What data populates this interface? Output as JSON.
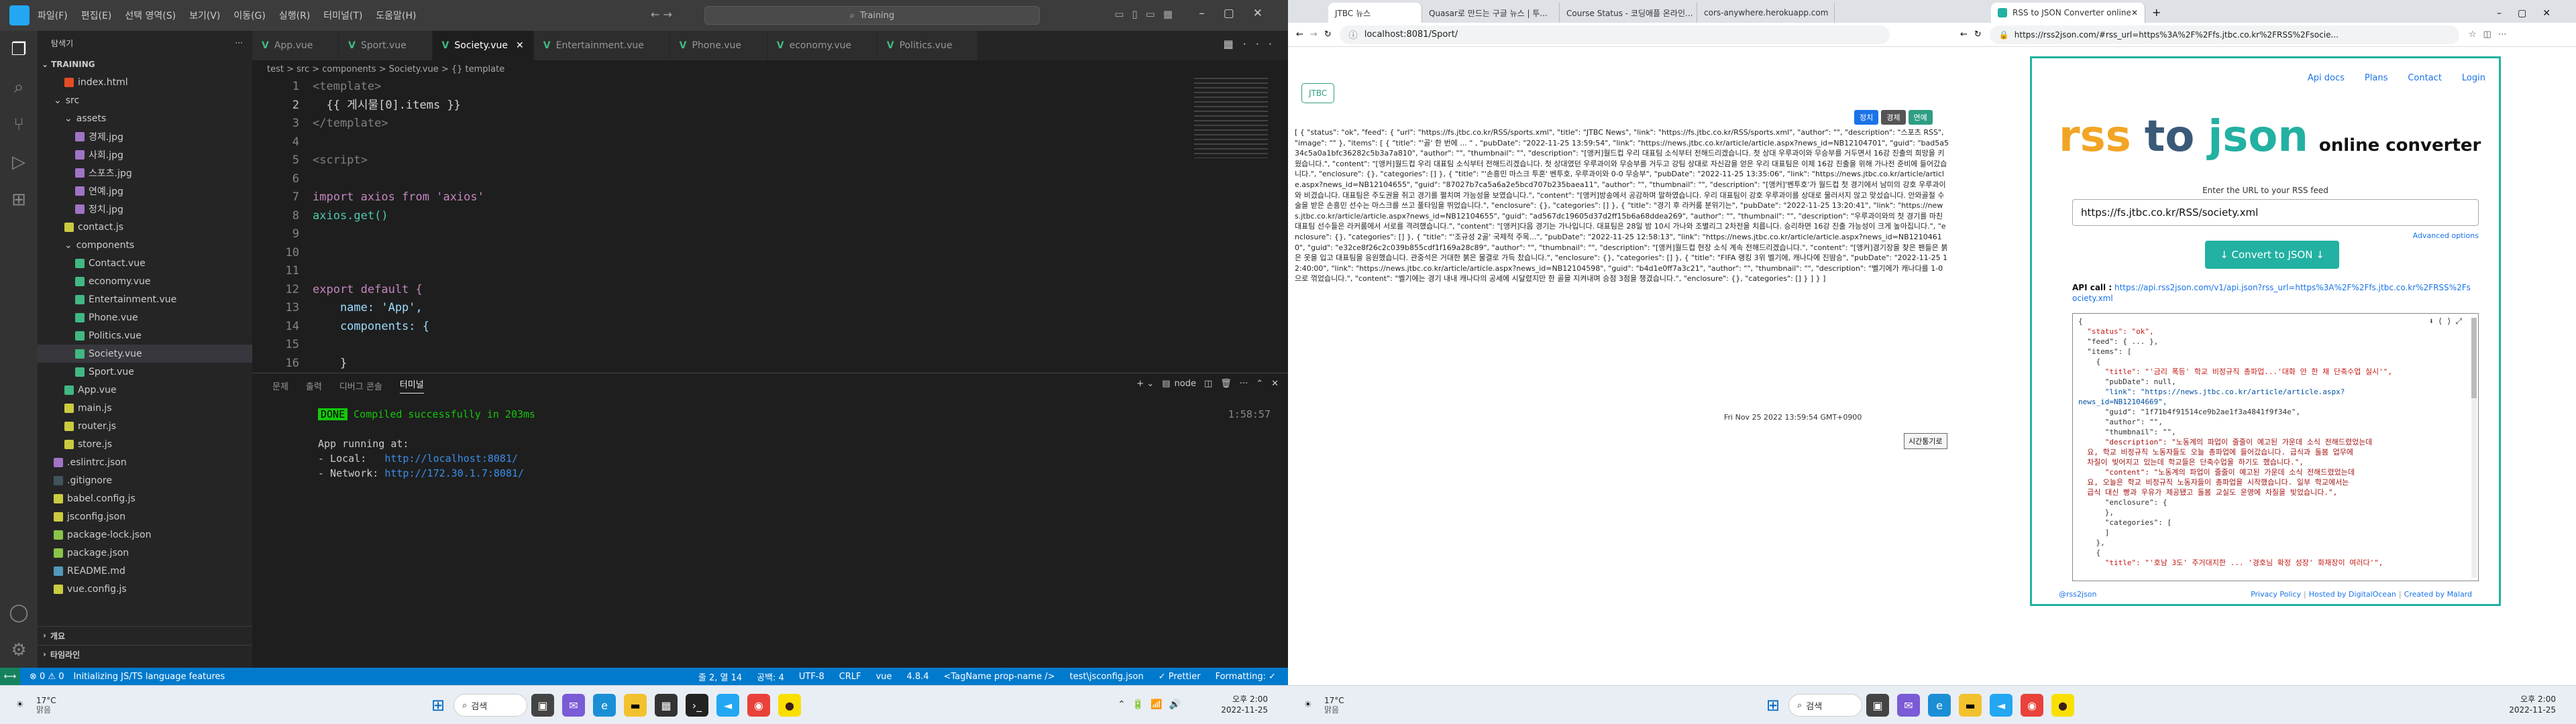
{
  "vscode": {
    "menu": [
      "파일(F)",
      "편집(E)",
      "선택 영역(S)",
      "보기(V)",
      "이동(G)",
      "실행(R)",
      "터미널(T)",
      "도움말(H)"
    ],
    "search": "Training",
    "explorer_title": "탐색기",
    "root": "TRAINING",
    "tree": [
      {
        "n": "index.html",
        "d": 2,
        "c": "#e44d26"
      },
      {
        "n": "src",
        "d": 1,
        "c": "",
        "folder": true
      },
      {
        "n": "assets",
        "d": 2,
        "c": "",
        "folder": true
      },
      {
        "n": "경제.jpg",
        "d": 3,
        "c": "#a074c4"
      },
      {
        "n": "사회.jpg",
        "d": 3,
        "c": "#a074c4"
      },
      {
        "n": "스포츠.jpg",
        "d": 3,
        "c": "#a074c4"
      },
      {
        "n": "연예.jpg",
        "d": 3,
        "c": "#a074c4"
      },
      {
        "n": "정치.jpg",
        "d": 3,
        "c": "#a074c4"
      },
      {
        "n": "contact.js",
        "d": 2,
        "c": "#cbcb41"
      },
      {
        "n": "components",
        "d": 2,
        "c": "",
        "folder": true
      },
      {
        "n": "Contact.vue",
        "d": 3,
        "c": "#41b883"
      },
      {
        "n": "economy.vue",
        "d": 3,
        "c": "#41b883"
      },
      {
        "n": "Entertainment.vue",
        "d": 3,
        "c": "#41b883"
      },
      {
        "n": "Phone.vue",
        "d": 3,
        "c": "#41b883"
      },
      {
        "n": "Politics.vue",
        "d": 3,
        "c": "#41b883"
      },
      {
        "n": "Society.vue",
        "d": 3,
        "c": "#41b883",
        "sel": true
      },
      {
        "n": "Sport.vue",
        "d": 3,
        "c": "#41b883"
      },
      {
        "n": "App.vue",
        "d": 2,
        "c": "#41b883"
      },
      {
        "n": "main.js",
        "d": 2,
        "c": "#cbcb41"
      },
      {
        "n": "router.js",
        "d": 2,
        "c": "#cbcb41"
      },
      {
        "n": "store.js",
        "d": 2,
        "c": "#cbcb41"
      },
      {
        "n": ".eslintrc.json",
        "d": 1,
        "c": "#a074c4"
      },
      {
        "n": ".gitignore",
        "d": 1,
        "c": "#41535b"
      },
      {
        "n": "babel.config.js",
        "d": 1,
        "c": "#cbcb41"
      },
      {
        "n": "jsconfig.json",
        "d": 1,
        "c": "#cbcb41"
      },
      {
        "n": "package-lock.json",
        "d": 1,
        "c": "#8bc34a"
      },
      {
        "n": "package.json",
        "d": 1,
        "c": "#8bc34a"
      },
      {
        "n": "README.md",
        "d": 1,
        "c": "#519aba"
      },
      {
        "n": "vue.config.js",
        "d": 1,
        "c": "#cbcb41"
      }
    ],
    "outline": "개요",
    "timeline": "타임라인",
    "tabs": [
      "App.vue",
      "Sport.vue",
      "Society.vue",
      "Entertainment.vue",
      "Phone.vue",
      "economy.vue",
      "Politics.vue"
    ],
    "active_tab": "Society.vue",
    "breadcrumb": "test > src > components > Society.vue > {} template",
    "code": [
      "<template>",
      "  {{ 게시물[0].items }}",
      "</template>",
      "",
      "<script>",
      "",
      "import axios from 'axios'",
      "axios.get()",
      "",
      "",
      "",
      "export default {",
      "    name: 'App',",
      "    components: {",
      "",
      "    }"
    ],
    "panel_tabs": [
      "문제",
      "출력",
      "디버그 콘솔",
      "터미널"
    ],
    "terminal_label": "node",
    "done_badge": "DONE",
    "done_msg": "Compiled successfully in 203ms",
    "done_time": "1:58:57",
    "app_running": "App running at:",
    "local_label": "- Local:   ",
    "local_url": "http://localhost:8081/",
    "network_label": "- Network: ",
    "network_url": "http://172.30.1.7:8081/",
    "status_left": "⊗ 0 ⚠ 0",
    "status_init": "Initializing JS/TS language features",
    "status_right": [
      "줄 2, 열 14",
      "공백: 4",
      "UTF-8",
      "CRLF",
      "vue",
      "4.8.4",
      "<TagName prop-name />",
      "test\\jsconfig.json",
      "✓ Prettier",
      "Formatting: ✓"
    ]
  },
  "taskbar1": {
    "weather": "17°C",
    "weather2": "맑음",
    "search": "검색",
    "time": "오후 2:00",
    "date": "2022-11-25"
  },
  "taskbar2": {
    "weather": "17°C",
    "weather2": "맑음",
    "search": "검색",
    "time": "오후 2:00",
    "date": "2022-11-25"
  },
  "browser1": {
    "tabs": [
      "JTBC 뉴스",
      "Quasar로 만드는 구글 뉴스 | 투...",
      "Course Status - 코딩애플 온라인...",
      "cors-anywhere.herokuapp.com"
    ],
    "url": "localhost:8081/Sport/",
    "jtbc_btn": "JTBC",
    "cats": [
      "정치",
      "경제",
      "연예"
    ],
    "json": "[ { \"status\": \"ok\", \"feed\": { \"url\": \"https://fs.jtbc.co.kr/RSS/sports.xml\", \"title\": \"JTBC News\", \"link\": \"https://fs.jtbc.co.kr/RSS/sports.xml\", \"author\": \"\", \"description\": \"스포츠 RSS\", \"image\": \"\" }, \"items\": [ { \"title\": \"'골' 한 번에 ... \" , \"pubDate\": \"2022-11-25 13:59:54\", \"link\": \"https://news.jtbc.co.kr/article/article.aspx?news_id=NB12104701\", \"guid\": \"bad5a534c5a0a1bfc36282c5b3a7a810\", \"author\": \"\", \"thumbnail\": \"\", \"description\": \"[앵커]월드컵 우리 대표팀 소식부터 전해드리겠습니다. 첫 상대 우루과이와 무승부를 거두면서 16강 진출의 희망을 키웠습니다.\", \"content\": \"[앵커]월드컵 우리 대표팀 소식부터 전해드리겠습니다. 첫 상대였던 우루과이와 무승부를 거두고 강팀 상대로 자신감을 얻은 우리 대표팀은 이제 16강 진출을 위해 가나전 준비에 들어갔습니다.\", \"enclosure\": {}, \"categories\": [] }, { \"title\": \"'손흥민 마스크 투혼' 벤투호, 우루과이와 0-0 무승부\", \"pubDate\": \"2022-11-25 13:35:06\", \"link\": \"https://news.jtbc.co.kr/article/article.aspx?news_id=NB12104655\", \"guid\": \"87027b7ca5a6a2e5bcd707b235baea11\", \"author\": \"\", \"thumbnail\": \"\", \"description\": \"[앵커]'벤투호'가 월드컵 첫 경기에서 남미의 강호 우루과이와 비겼습니다. 대표팀은 주도권을 쥐고 경기를 펼치며 가능성을 보였습니다.\", \"content\": \"[앵커]방송에서 공감하며 말하였습니다. 우리 대표팀이 강호 우루과이를 상대로 물러서지 않고 맞섰습니다. 안와골절 수술을 받은 손흥민 선수는 마스크를 쓰고 풀타임을 뛰었습니다.\", \"enclosure\": {}, \"categories\": [] }, { \"title\": \"경기 후 라커룸 분위기는\", \"pubDate\": \"2022-11-25 13:20:41\", \"link\": \"https://news.jtbc.co.kr/article/article.aspx?news_id=NB12104655\", \"guid\": \"ad567dc19605d37d2ff15b6a68ddea269\", \"author\": \"\", \"thumbnail\": \"\", \"description\": \"우루과이와의 첫 경기를 마친 대표팀 선수들은 라커룸에서 서로를 격려했습니다.\", \"content\": \"[앵커]다음 경기는 가나입니다. 대표팀은 28일 밤 10시 가나와 조별리그 2차전을 치릅니다. 승리하면 16강 진출 가능성이 크게 높아집니다.\", \"enclosure\": {}, \"categories\": [] }, { \"title\": \"'조규성 2골' 국제적 주목...\", \"pubDate\": \"2022-11-25 12:58:13\", \"link\": \"https://news.jtbc.co.kr/article/article.aspx?news_id=NB12104610\", \"guid\": \"e32ce8f26c2c039b855cdf1f169a28c89\", \"author\": \"\", \"thumbnail\": \"\", \"description\": \"[앵커]월드컵 현장 소식 계속 전해드리겠습니다.\", \"content\": \"[앵커]경기장을 찾은 팬들은 붉은 옷을 입고 대표팀을 응원했습니다. 관중석은 거대한 붉은 물결로 가득 찼습니다.\", \"enclosure\": {}, \"categories\": [] }, { \"title\": \"FIFA 랭킹 3위 벨기에, 캐나다에 진땀승\", \"pubDate\": \"2022-11-25 12:40:00\", \"link\": \"https://news.jtbc.co.kr/article/article.aspx?news_id=NB12104598\", \"guid\": \"b4d1e0ff7a3c21\", \"author\": \"\", \"thumbnail\": \"\", \"description\": \"벨기에가 캐나다를 1-0으로 꺾었습니다.\", \"content\": \"벨기에는 경기 내내 캐나다의 공세에 시달렸지만 한 골을 지켜내며 승점 3점을 챙겼습니다.\", \"enclosure\": {}, \"categories\": [] } ] } ]",
    "date_line": "Fri Nov 25 2022 13:59:54 GMT+0900",
    "sort_btn": "시간통기로"
  },
  "browser2": {
    "tab": "RSS to JSON Converter online",
    "url": "https://rss2json.com/#rss_url=https%3A%2F%2Ffs.jtbc.co.kr%2FRSS%2Fsocie...",
    "nav": [
      "Api docs",
      "Plans",
      "Contact",
      "Login"
    ],
    "logo_rss": "rss",
    "logo_to": "to",
    "logo_json": "json",
    "logo_sub": "online converter",
    "prompt": "Enter the URL to your RSS feed",
    "input_val": "https://fs.jtbc.co.kr/RSS/society.xml",
    "advanced": "Advanced options",
    "convert_btn": "↓ Convert to JSON ↓",
    "api_label": "API call :",
    "api_url": "https://api.rss2json.com/v1/api.json?rss_url=https%3A%2F%2Ffs.jtbc.co.kr%2FRSS%2Fsociety.xml",
    "json_lines": [
      "{",
      "  \"status\": \"ok\",",
      "  \"feed\": { ... },",
      "  \"items\": [",
      "    {",
      "      \"title\": \"'금리 폭등' 학교 비정규직 총파업...'대화 안 한 채 단축수업 실시'\",",
      "      \"pubDate\": null,",
      "      \"link\": \"https://news.jtbc.co.kr/article/article.aspx?",
      "news_id=NB12104669\",",
      "      \"guid\": \"1f71b4f91514ce9b2ae1f3a4841f9f34e\",",
      "      \"author\": \"\",",
      "      \"thumbnail\": \"\",",
      "      \"description\": \"노동계의 파업이 줄줄이 예고된 가운데 소식 전해드렸었는데",
      "  요, 학교 비정규직 노동자들도 오늘 총파업에 들어갔습니다. 급식과 돌봄 업무에",
      "  차질이 빚어지고 있는데 학교들은 단축수업을 하기도 했습니다.\",",
      "      \"content\": \"노동계의 파업이 줄줄이 예고된 가운데 소식 전해드렸었는데",
      "  요, 오늘은 학교 비정규직 노동자들이 총파업을 시작했습니다. 일부 학교에서는",
      "  급식 대신 빵과 우유가 제공됐고 돌봄 교실도 운영에 차질을 빚었습니다.\",",
      "      \"enclosure\": {",
      "      },",
      "      \"categories\": [",
      "      ]",
      "    },",
      "    {",
      "      \"title\": \"'호남 3도' 주거대지한 ... '경호님 확정 성장' 화재장이 여러다'\","
    ],
    "footer_left": "@rss2json",
    "footer_right": [
      "Privacy Policy",
      "Hosted by DigitalOcean",
      "Created by Malard"
    ]
  }
}
